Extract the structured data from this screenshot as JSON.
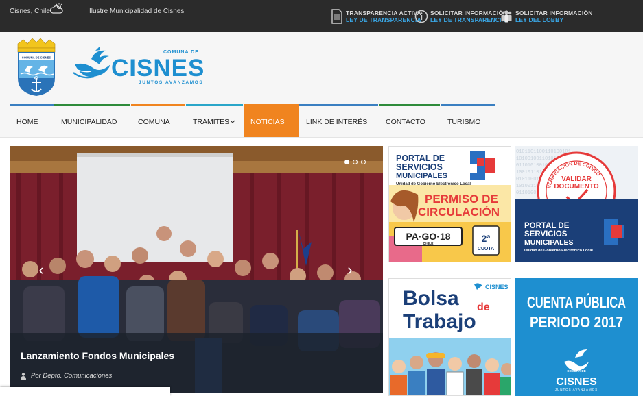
{
  "topbar": {
    "location": "Cisnes, Chile",
    "municipality": "Ilustre Municipalidad de Cisnes",
    "links": [
      {
        "line1": "TRANSPARENCIA ACTIVA",
        "line2": "LEY DE TRANSPARENCIA",
        "icon": "document-icon"
      },
      {
        "line1": "SOLICITAR INFORMACIÓN",
        "line2": "LEY DE TRANSPARENCIA",
        "icon": "info-icon"
      },
      {
        "line1": "SOLICITAR INFORMACIÓN",
        "line2": "LEY DEL LOBBY",
        "icon": "people-icon"
      }
    ]
  },
  "logo": {
    "comuna_de": "COMUNA DE",
    "name": "CISNES",
    "tagline": "JUNTOS AVANZAMOS",
    "crest_text": "COMUNA DE CISNES"
  },
  "nav": {
    "items": [
      {
        "label": "HOME",
        "color": "#3a7fc1"
      },
      {
        "label": "MUNICIPALIDAD",
        "color": "#2e8b3a"
      },
      {
        "label": "COMUNA",
        "color": "#f0841f"
      },
      {
        "label": "TRAMITES",
        "color": "#2aa6c9"
      },
      {
        "label": "NOTICIAS",
        "color": "#f0841f"
      },
      {
        "label": "LINK DE INTERÉS",
        "color": "#3a7fc1"
      },
      {
        "label": "CONTACTO",
        "color": "#2e8b3a"
      },
      {
        "label": "TURISMO",
        "color": "#3a7fc1"
      }
    ],
    "active": "NOTICIAS"
  },
  "slider": {
    "title": "Lanzamiento Fondos Municipales",
    "author": "Por Depto. Comunicaciones",
    "slide_count": 3,
    "active_slide": 1
  },
  "banners": {
    "portal": {
      "l1": "PORTAL DE",
      "l2": "SERVICIOS",
      "l3": "MUNICIPALES",
      "sub": "Unidad de Gobierno Electrónico Local"
    },
    "permiso": {
      "l1": "PERMISO DE",
      "l2": "CIRCULACIÓN",
      "plate": "PA·GO·18",
      "plate_sub": "CHILE",
      "cuota_num": "2ª",
      "cuota": "CUOTA"
    },
    "validar": {
      "ring": "VERIFICACIÓN DE CÓDIGO",
      "l1": "VALIDAR",
      "l2": "DOCUMENTO"
    },
    "bolsa": {
      "brand": "CISNES",
      "l1": "Bolsa",
      "de": "de",
      "l2": "Trabajo"
    },
    "cuenta": {
      "l1": "CUENTA PÚBLICA",
      "l2": "PERIODO 2017",
      "small": "COMUNA DE",
      "brand": "CISNES",
      "tag": "JUNTOS AVANZAMOS"
    }
  },
  "colors": {
    "topbar": "#2b2b2b",
    "accent_blue": "#3aa7e6",
    "active_nav": "#f0841f",
    "logo_blue": "#1e8fd0"
  }
}
